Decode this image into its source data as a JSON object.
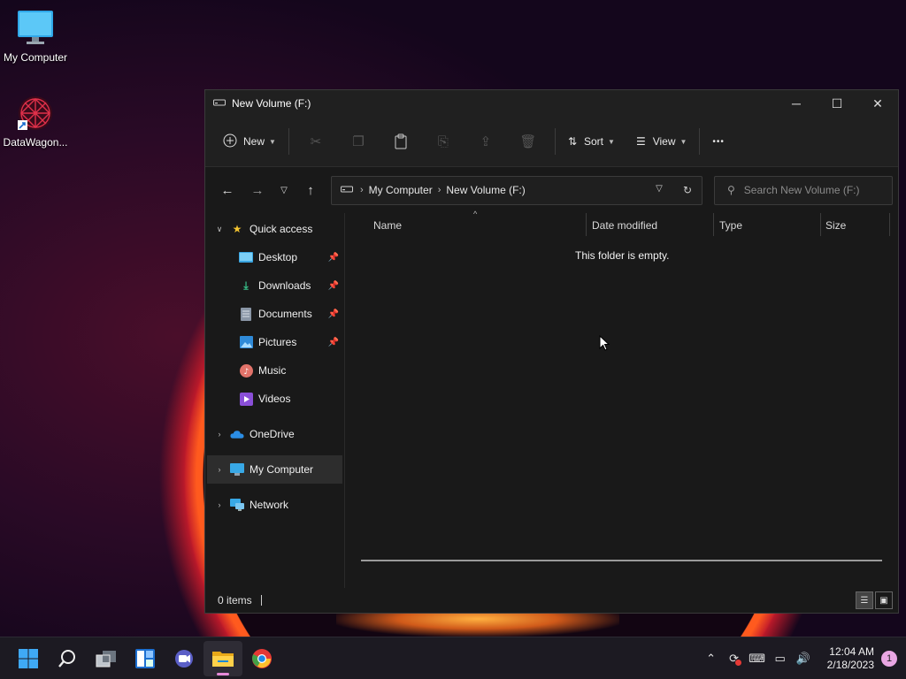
{
  "desktop": {
    "icons": [
      {
        "label": "My Computer",
        "icon": "monitor-icon"
      },
      {
        "label": "DataWagon...",
        "icon": "datawagon-app-icon"
      }
    ]
  },
  "window": {
    "title": "New Volume (F:)",
    "controls": {
      "minimize": "─",
      "maximize": "☐",
      "close": "✕"
    },
    "commandbar": {
      "new_label": "New",
      "sort_label": "Sort",
      "view_label": "View",
      "more_label": "•••"
    },
    "address": {
      "crumbs": [
        "My Computer",
        "New Volume (F:)"
      ],
      "search_placeholder": "Search New Volume (F:)"
    },
    "sidebar": {
      "quick_access": "Quick access",
      "items": [
        {
          "label": "Desktop",
          "pinned": true,
          "icon": "desktop-folder-icon"
        },
        {
          "label": "Downloads",
          "pinned": true,
          "icon": "download-icon"
        },
        {
          "label": "Documents",
          "pinned": true,
          "icon": "document-icon"
        },
        {
          "label": "Pictures",
          "pinned": true,
          "icon": "pictures-icon"
        },
        {
          "label": "Music",
          "pinned": false,
          "icon": "music-icon"
        },
        {
          "label": "Videos",
          "pinned": false,
          "icon": "videos-icon"
        }
      ],
      "onedrive": "OneDrive",
      "mycomputer": "My Computer",
      "network": "Network"
    },
    "columns": [
      "Name",
      "Date modified",
      "Type",
      "Size"
    ],
    "empty_text": "This folder is empty.",
    "status": "0 items"
  },
  "taskbar": {
    "time": "12:04 AM",
    "date": "2/18/2023",
    "notifications": "1",
    "apps": [
      "start-icon",
      "search-icon",
      "task-view-icon",
      "widgets-icon",
      "chat-icon",
      "file-explorer-icon",
      "chrome-icon"
    ]
  },
  "colors": {
    "window_bg": "#191919",
    "accent": "#e58ad9"
  }
}
